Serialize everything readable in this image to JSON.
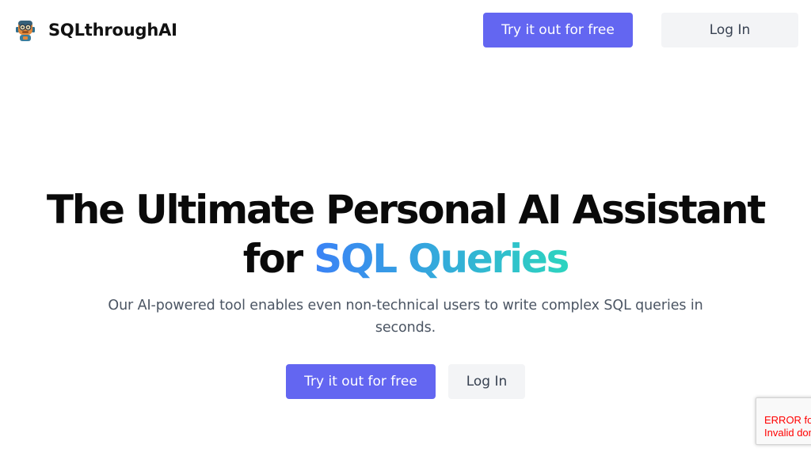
{
  "header": {
    "brand_name": "SQLthroughAI",
    "logo_icon": "robot-mascot-icon",
    "try_label": "Try it out for free",
    "login_label": "Log In"
  },
  "hero": {
    "title_line1": "The Ultimate Personal AI Assistant",
    "title_line2_prefix": "for",
    "title_line2_highlight": "SQL Queries",
    "subtitle": "Our AI-powered tool enables even non-technical users to write complex SQL queries in seconds.",
    "try_label": "Try it out for free",
    "login_label": "Log In"
  },
  "recaptcha": {
    "line1": "ERROR for",
    "line2": "Invalid dom"
  },
  "colors": {
    "primary_button": "#6366f1",
    "secondary_button": "#f3f4f6",
    "gradient_start": "#3b82f6",
    "gradient_end": "#2dd4bf",
    "error_text": "#ff0000"
  }
}
